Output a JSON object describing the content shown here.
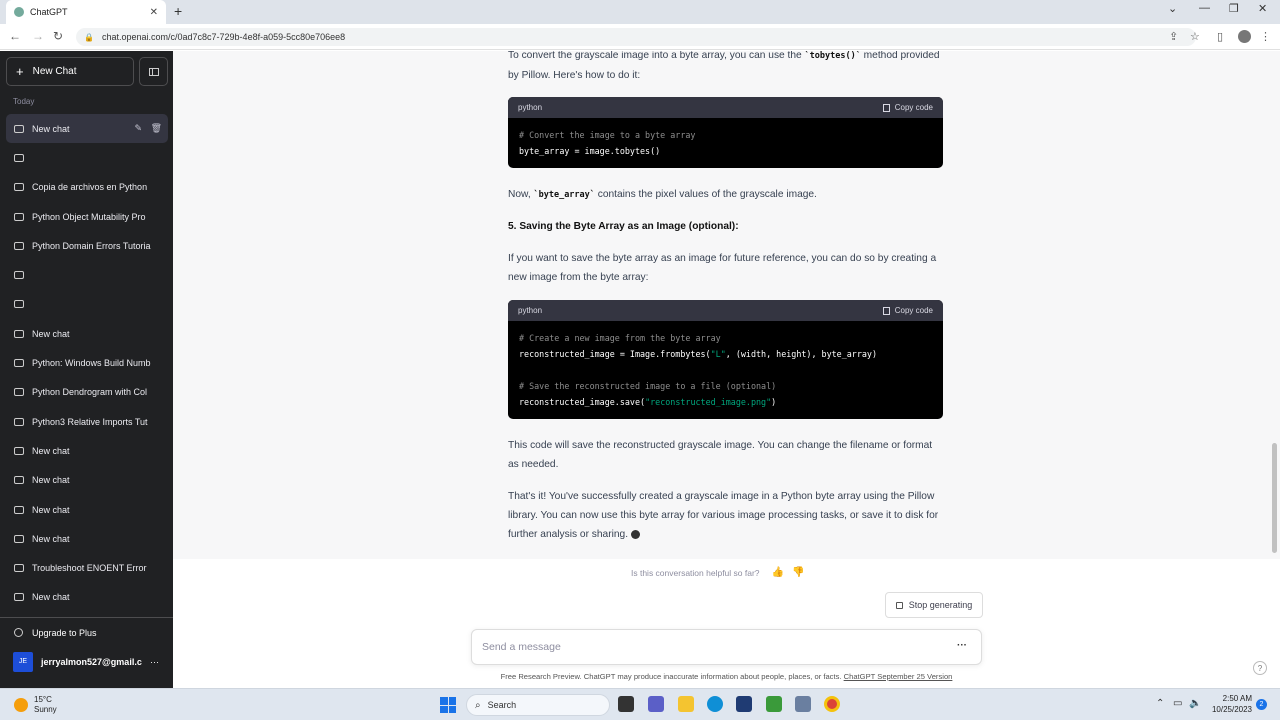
{
  "browser": {
    "tab_title": "ChatGPT",
    "tab_close": "✕",
    "new_tab": "+",
    "url": "chat.openai.com/c/0ad7c8c7-729b-4e8f-a059-5cc80e706ee8"
  },
  "sidebar": {
    "new_chat_label": "New Chat",
    "section_label": "Today",
    "items": [
      {
        "label": "New chat"
      },
      {
        "label": ""
      },
      {
        "label": "Copia de archivos en Python"
      },
      {
        "label": "Python Object Mutability Pro"
      },
      {
        "label": "Python Domain Errors Tutoria"
      },
      {
        "label": ""
      },
      {
        "label": ""
      },
      {
        "label": "New chat"
      },
      {
        "label": "Python: Windows Build Numb"
      },
      {
        "label": "Python Dendrogram with Col"
      },
      {
        "label": "Python3 Relative Imports Tut"
      },
      {
        "label": "New chat"
      },
      {
        "label": "New chat"
      },
      {
        "label": "New chat"
      },
      {
        "label": "New chat"
      },
      {
        "label": "Troubleshoot ENOENT Error"
      },
      {
        "label": "New chat"
      }
    ],
    "upgrade_label": "Upgrade to Plus",
    "account_initials": "JE",
    "account_email": "jerryalmon527@gmail.c",
    "account_more": "···"
  },
  "conversation": {
    "p1_a": "To convert the grayscale image into a byte array, you can use the ",
    "p1_code": "`tobytes()`",
    "p1_b": " method provided by Pillow. Here's how to do it:",
    "code1": {
      "lang": "python",
      "copy_label": "Copy code",
      "line1": "# Convert the image to a byte array",
      "line2": "byte_array = image.tobytes()"
    },
    "p2_a": "Now, ",
    "p2_code": "`byte_array`",
    "p2_b": " contains the pixel values of the grayscale image.",
    "heading5": "5. Saving the Byte Array as an Image (optional):",
    "p3": "If you want to save the byte array as an image for future reference, you can do so by creating a new image from the byte array:",
    "code2": {
      "lang": "python",
      "copy_label": "Copy code",
      "line1": "# Create a new image from the byte array",
      "line2_a": "reconstructed_image = Image.frombytes(",
      "line2_str": "\"L\"",
      "line2_b": ", (width, height), byte_array)",
      "line3": "# Save the reconstructed image to a file (optional)",
      "line4_a": "reconstructed_image.save(",
      "line4_str": "\"reconstructed_image.png\"",
      "line4_b": ")"
    },
    "p4": "This code will save the reconstructed grayscale image. You can change the filename or format as needed.",
    "p5": "That's it! You've successfully created a grayscale image in a Python byte array using the Pillow library. You can now use this byte array for various image processing tasks, or save it to disk for further analysis or sharing."
  },
  "bottom": {
    "feedback_q": "Is this conversation helpful so far?",
    "stop_label": "Stop generating",
    "input_placeholder": "Send a message",
    "input_more": "···",
    "disclaimer": "Free Research Preview. ChatGPT may produce inaccurate information about people, places, or facts. ",
    "disclaimer_link": "ChatGPT September 25 Version",
    "help": "?"
  },
  "taskbar": {
    "temp": "15°C",
    "condition": "Sunny",
    "search_label": "Search",
    "time": "2:50 AM",
    "date": "10/25/2023",
    "notif_count": "2"
  },
  "colors": {
    "sidebar_bg": "#202123",
    "main_bg": "#f7f7f8",
    "code_bg": "#000000",
    "code_string": "#00a67d"
  }
}
